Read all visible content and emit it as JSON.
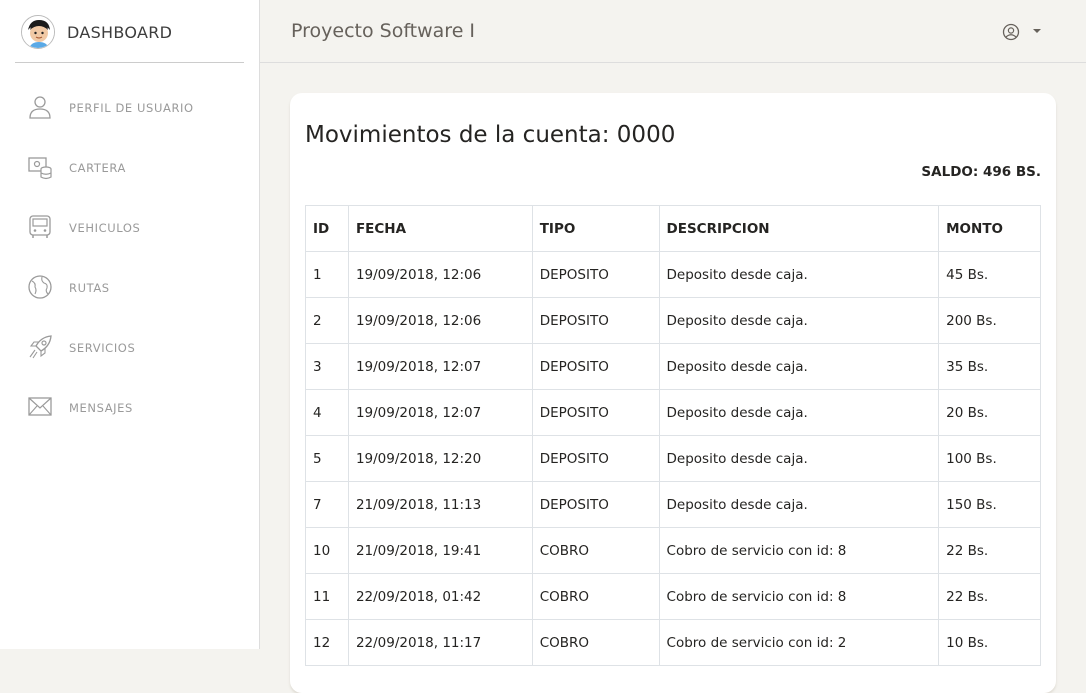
{
  "sidebar": {
    "brand": "DASHBOARD",
    "items": [
      {
        "label": "PERFIL DE USUARIO",
        "icon": "user-icon"
      },
      {
        "label": "CARTERA",
        "icon": "wallet-icon"
      },
      {
        "label": "VEHICULOS",
        "icon": "bus-icon"
      },
      {
        "label": "RUTAS",
        "icon": "globe-icon"
      },
      {
        "label": "SERVICIOS",
        "icon": "rocket-icon"
      },
      {
        "label": "MENSAJES",
        "icon": "mail-icon"
      }
    ]
  },
  "header": {
    "title": "Proyecto Software I"
  },
  "main": {
    "title": "Movimientos de la cuenta: 0000",
    "saldo": "SALDO: 496 BS.",
    "columns": [
      "ID",
      "FECHA",
      "TIPO",
      "DESCRIPCION",
      "MONTO"
    ],
    "rows": [
      [
        "1",
        "19/09/2018, 12:06",
        "DEPOSITO",
        "Deposito desde caja.",
        "45 Bs."
      ],
      [
        "2",
        "19/09/2018, 12:06",
        "DEPOSITO",
        "Deposito desde caja.",
        "200 Bs."
      ],
      [
        "3",
        "19/09/2018, 12:07",
        "DEPOSITO",
        "Deposito desde caja.",
        "35 Bs."
      ],
      [
        "4",
        "19/09/2018, 12:07",
        "DEPOSITO",
        "Deposito desde caja.",
        "20 Bs."
      ],
      [
        "5",
        "19/09/2018, 12:20",
        "DEPOSITO",
        "Deposito desde caja.",
        "100 Bs."
      ],
      [
        "7",
        "21/09/2018, 11:13",
        "DEPOSITO",
        "Deposito desde caja.",
        "150 Bs."
      ],
      [
        "10",
        "21/09/2018, 19:41",
        "COBRO",
        "Cobro de servicio con id: 8",
        "22 Bs."
      ],
      [
        "11",
        "22/09/2018, 01:42",
        "COBRO",
        "Cobro de servicio con id: 8",
        "22 Bs."
      ],
      [
        "12",
        "22/09/2018, 11:17",
        "COBRO",
        "Cobro de servicio con id: 2",
        "10 Bs."
      ]
    ]
  }
}
